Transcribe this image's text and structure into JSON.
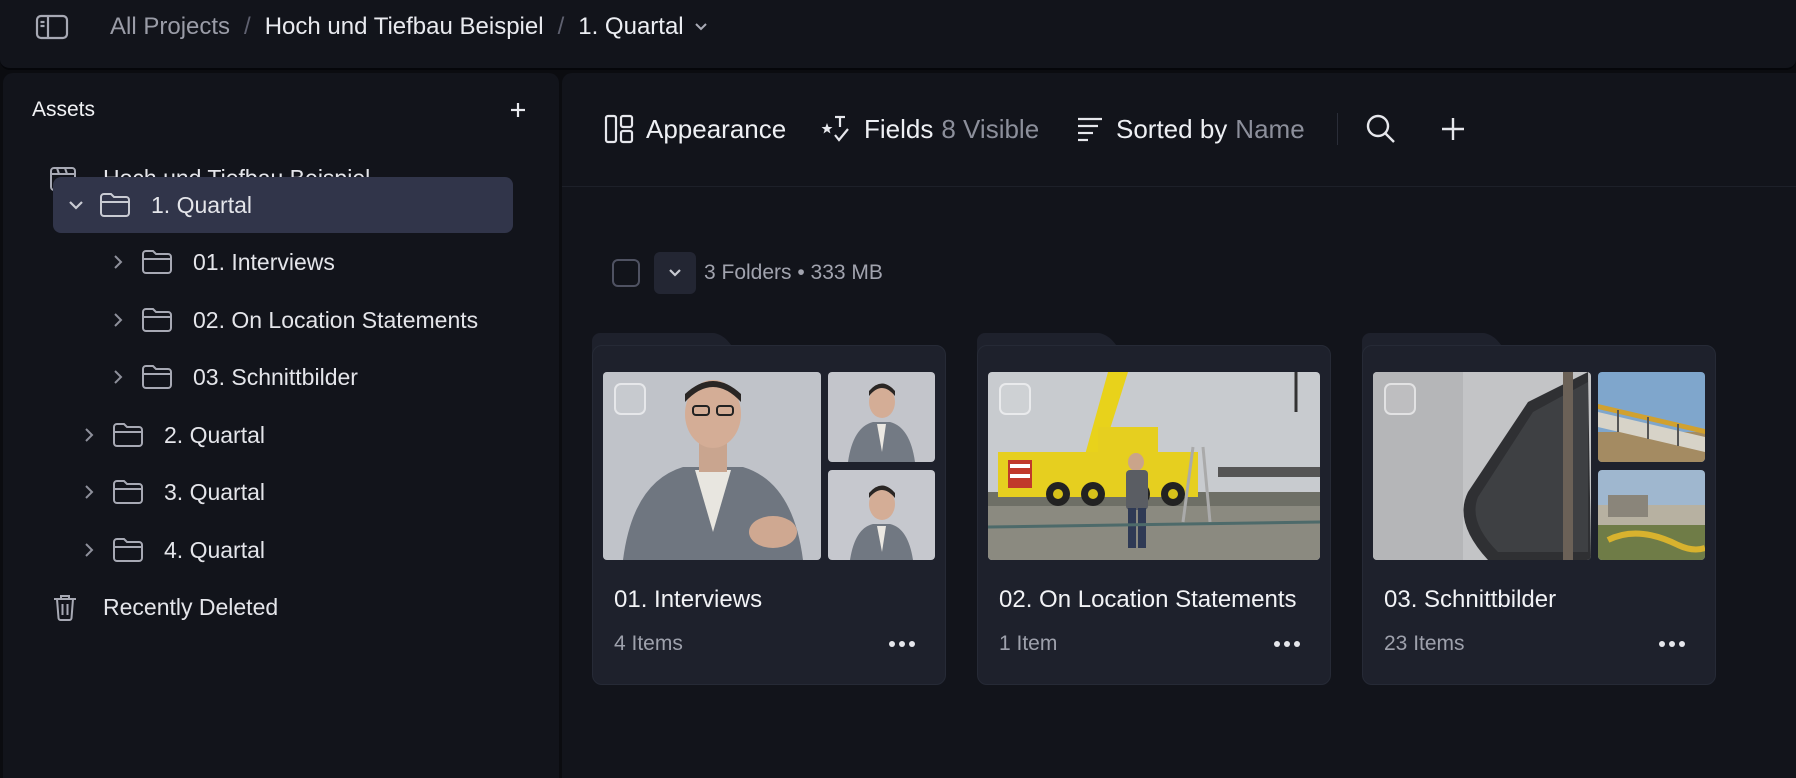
{
  "breadcrumb": {
    "root": "All Projects",
    "project": "Hoch und Tiefbau Beispiel",
    "current": "1. Quartal",
    "separator": "/"
  },
  "sidebar": {
    "title": "Assets",
    "project": {
      "label": "Hoch und Tiefbau Beispiel",
      "icon": "project-icon"
    },
    "items": [
      {
        "label": "1. Quartal",
        "level": 1,
        "expanded": true,
        "selected": true
      },
      {
        "label": "01. Interviews",
        "level": 2,
        "expanded": false
      },
      {
        "label": "02. On Location Statements",
        "level": 2,
        "expanded": false
      },
      {
        "label": "03. Schnittbilder",
        "level": 2,
        "expanded": false
      },
      {
        "label": "2. Quartal",
        "level": 1,
        "expanded": false
      },
      {
        "label": "3. Quartal",
        "level": 1,
        "expanded": false
      },
      {
        "label": "4. Quartal",
        "level": 1,
        "expanded": false
      }
    ],
    "deleted": {
      "label": "Recently Deleted",
      "icon": "trash-icon"
    }
  },
  "toolbar": {
    "appearance": "Appearance",
    "fields": "Fields",
    "fields_count": "8 Visible",
    "sorted_by": "Sorted by",
    "sort_field": "Name"
  },
  "summary": "3 Folders • 333 MB",
  "cards": [
    {
      "title": "01. Interviews",
      "count": "4 Items"
    },
    {
      "title": "02. On Location Statements",
      "count": "1 Item"
    },
    {
      "title": "03. Schnittbilder",
      "count": "23 Items"
    }
  ],
  "colors": {
    "background": "#12141b",
    "selected": "#31354a",
    "card": "#1e212c",
    "text": "#e6e7ec",
    "muted": "#8c8f9b"
  }
}
